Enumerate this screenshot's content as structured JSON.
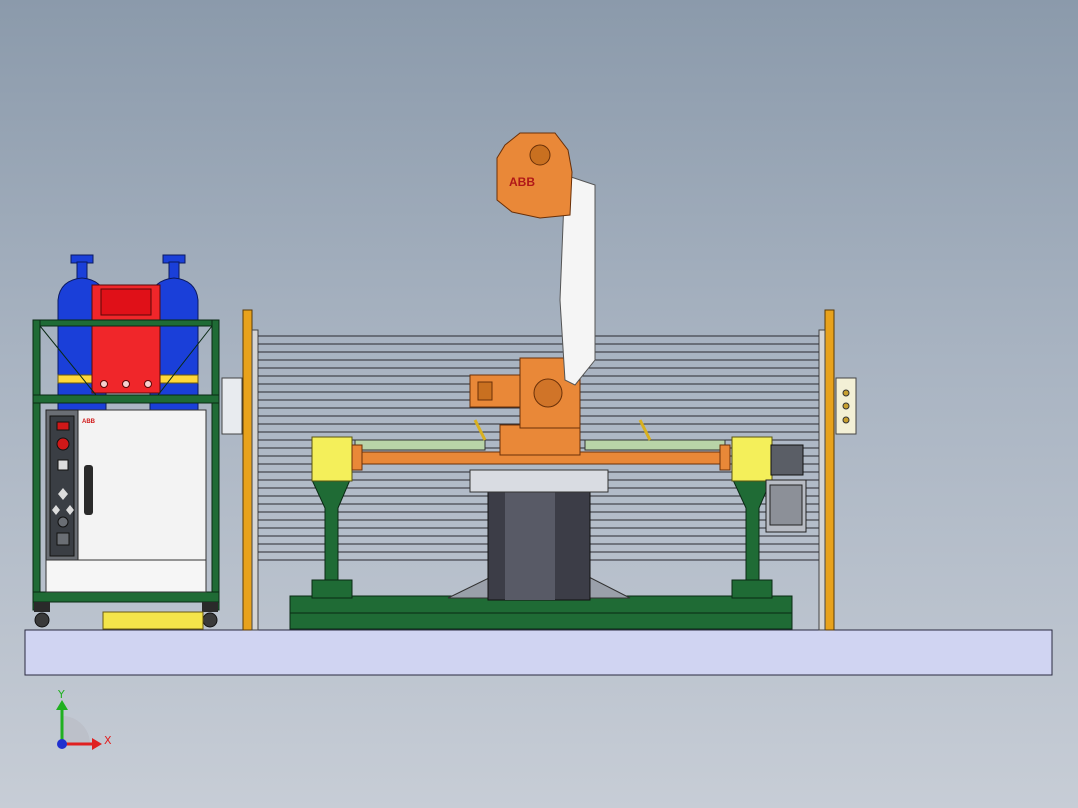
{
  "scene": {
    "robot_brand_label": "ABB",
    "cabinet_brand_label": "ABB"
  },
  "triad": {
    "x_label": "X",
    "y_label": "Y",
    "x_color": "#e02020",
    "y_color": "#20b020",
    "z_color": "#2030d0"
  },
  "colors": {
    "background_top": "#8b9aab",
    "background_bottom": "#c7cdd6",
    "floor_plate": "#d0d4f2",
    "frame_green": "#1f6b35",
    "gas_cylinder_blue": "#1a3fd9",
    "welding_power_red": "#f0262a",
    "robot_orange": "#e98838",
    "positioner_yellow": "#f4ef5a",
    "fence_orange": "#e8a21c"
  }
}
